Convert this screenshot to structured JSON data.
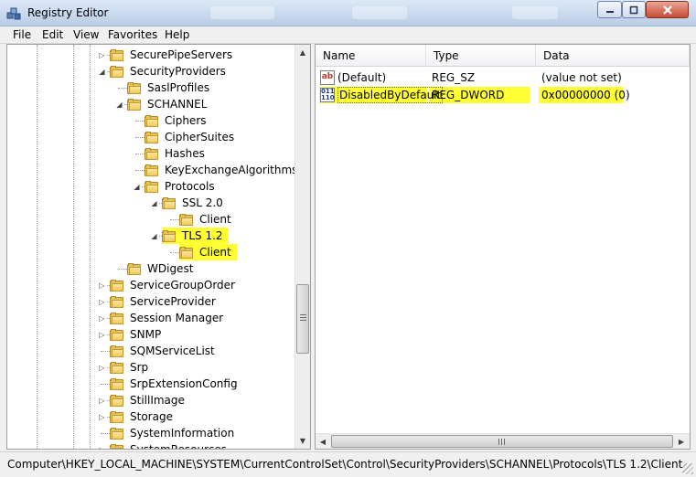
{
  "window": {
    "title": "Registry Editor"
  },
  "menu": [
    "File",
    "Edit",
    "View",
    "Favorites",
    "Help"
  ],
  "tree": {
    "items": [
      {
        "label": "SecurePipeServers",
        "level": 0,
        "expander": "collapsed"
      },
      {
        "label": "SecurityProviders",
        "level": 0,
        "expander": "expanded"
      },
      {
        "label": "SaslProfiles",
        "level": 1,
        "expander": "none"
      },
      {
        "label": "SCHANNEL",
        "level": 1,
        "expander": "expanded"
      },
      {
        "label": "Ciphers",
        "level": 2,
        "expander": "none"
      },
      {
        "label": "CipherSuites",
        "level": 2,
        "expander": "none"
      },
      {
        "label": "Hashes",
        "level": 2,
        "expander": "none"
      },
      {
        "label": "KeyExchangeAlgorithms",
        "level": 2,
        "expander": "none"
      },
      {
        "label": "Protocols",
        "level": 2,
        "expander": "expanded"
      },
      {
        "label": "SSL 2.0",
        "level": 3,
        "expander": "expanded"
      },
      {
        "label": "Client",
        "level": 4,
        "expander": "none"
      },
      {
        "label": "TLS 1.2",
        "level": 3,
        "expander": "expanded",
        "highlight": true
      },
      {
        "label": "Client",
        "level": 4,
        "expander": "none",
        "highlight": true,
        "selected": true
      },
      {
        "label": "WDigest",
        "level": 1,
        "expander": "none"
      },
      {
        "label": "ServiceGroupOrder",
        "level": 0,
        "expander": "collapsed"
      },
      {
        "label": "ServiceProvider",
        "level": 0,
        "expander": "collapsed"
      },
      {
        "label": "Session Manager",
        "level": 0,
        "expander": "collapsed"
      },
      {
        "label": "SNMP",
        "level": 0,
        "expander": "collapsed"
      },
      {
        "label": "SQMServiceList",
        "level": 0,
        "expander": "none"
      },
      {
        "label": "Srp",
        "level": 0,
        "expander": "collapsed"
      },
      {
        "label": "SrpExtensionConfig",
        "level": 0,
        "expander": "none"
      },
      {
        "label": "StillImage",
        "level": 0,
        "expander": "collapsed"
      },
      {
        "label": "Storage",
        "level": 0,
        "expander": "collapsed"
      },
      {
        "label": "SystemInformation",
        "level": 0,
        "expander": "none"
      },
      {
        "label": "SystemResources",
        "level": 0,
        "expander": "collapsed"
      }
    ]
  },
  "list": {
    "columns": [
      "Name",
      "Type",
      "Data"
    ],
    "rows": [
      {
        "name": "(Default)",
        "type": "REG_SZ",
        "data": "(value not set)",
        "icon": "string-value-icon",
        "icon_text": "ab"
      },
      {
        "name": "DisabledByDefault",
        "type": "REG_DWORD",
        "data": "0x00000000 (0)",
        "icon": "binary-value-icon",
        "icon_text": "011 110",
        "highlight": true
      }
    ]
  },
  "status": {
    "path": "Computer\\HKEY_LOCAL_MACHINE\\SYSTEM\\CurrentControlSet\\Control\\SecurityProviders\\SCHANNEL\\Protocols\\TLS 1.2\\Client"
  },
  "colors": {
    "highlight": "#ffff33",
    "folder": "#f0c95a",
    "titlebar": "#c9d7ea"
  }
}
